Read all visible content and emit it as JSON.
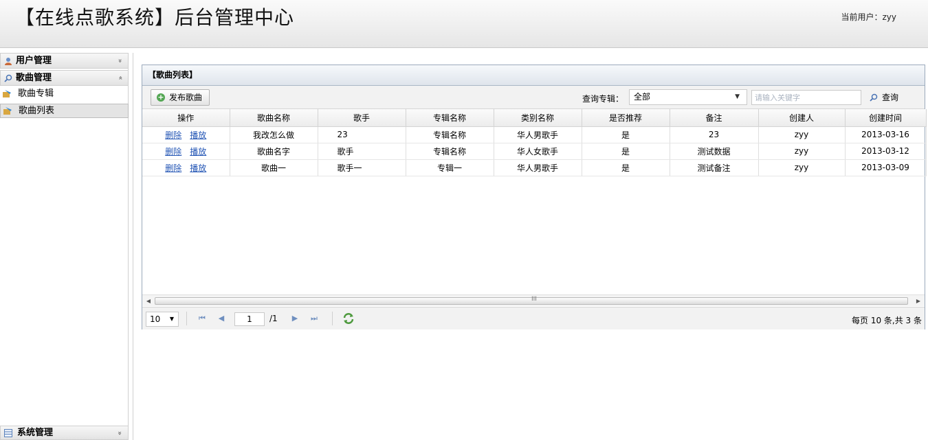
{
  "header": {
    "app_title": "【在线点歌系统】后台管理中心",
    "user_label": "当前用户：zyy"
  },
  "sidebar": {
    "sections": [
      {
        "label": "用户管理",
        "icon": "user-icon",
        "toggle": "«",
        "expanded": false
      },
      {
        "label": "歌曲管理",
        "icon": "search-icon",
        "toggle": "«",
        "expanded": true,
        "items": [
          {
            "label": "歌曲专辑",
            "icon": "music-album-icon",
            "active": false
          },
          {
            "label": "歌曲列表",
            "icon": "music-list-icon",
            "active": true
          }
        ]
      }
    ],
    "system": {
      "label": "系统管理",
      "icon": "grid-icon",
      "toggle": "«"
    }
  },
  "panel": {
    "title": "【歌曲列表】",
    "toolbar": {
      "publish_label": "发布歌曲",
      "album_label": "查询专辑：",
      "album_selected": "全部",
      "search_placeholder": "请输入关键字",
      "search_label": "查询"
    },
    "columns": [
      "操作",
      "歌曲名称",
      "歌手",
      "专辑名称",
      "类别名称",
      "是否推荐",
      "备注",
      "创建人",
      "创建时间"
    ],
    "row_actions": [
      "删除",
      "播放"
    ],
    "rows": [
      {
        "name": "我改怎么做",
        "singer": "23",
        "album": "专辑名称",
        "category": "华人男歌手",
        "recommended": "是",
        "remark": "23",
        "creator": "zyy",
        "created": "2013-03-16"
      },
      {
        "name": "歌曲名字",
        "singer": "歌手",
        "album": "专辑名称",
        "category": "华人女歌手",
        "recommended": "是",
        "remark": "测试数据",
        "creator": "zyy",
        "created": "2013-03-12"
      },
      {
        "name": "歌曲一",
        "singer": "歌手一",
        "album": "专辑一",
        "category": "华人男歌手",
        "recommended": "是",
        "remark": "测试备注",
        "creator": "zyy",
        "created": "2013-03-09"
      }
    ],
    "scroll_grip": "III",
    "pager": {
      "page_size": "10",
      "current_page": "1",
      "total_pages": "/1",
      "summary": "每页 10 条,共 3 条"
    }
  },
  "colors": {
    "link": "#2456b5",
    "nav": "#6f8fbf",
    "panel_border": "#9aa9bb"
  }
}
